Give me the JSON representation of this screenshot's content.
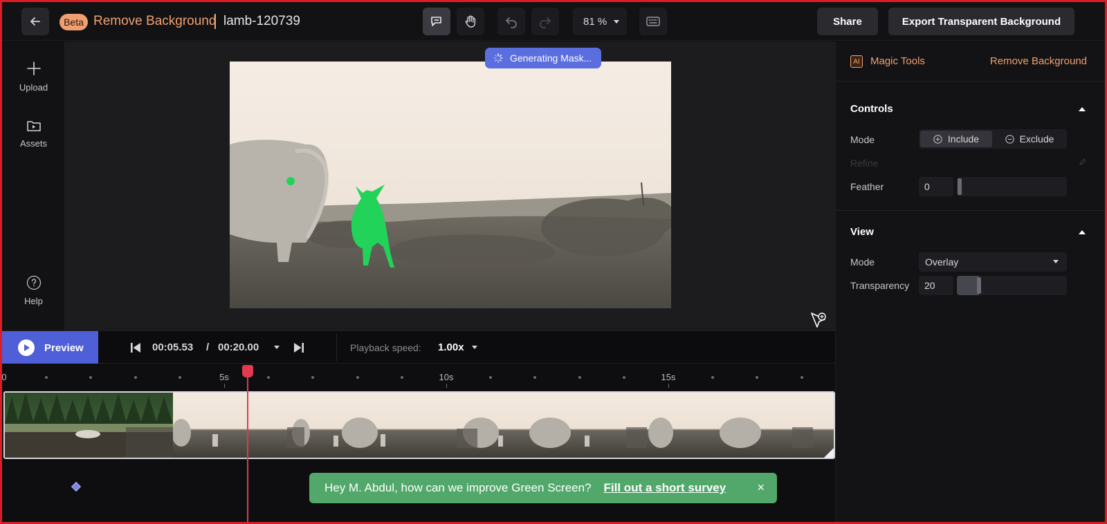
{
  "header": {
    "badge": "Beta",
    "app_title": "Remove Background",
    "file_name": "lamb-120739",
    "zoom": "81 %",
    "share_label": "Share",
    "export_label": "Export Transparent Background"
  },
  "sidebar": {
    "items": [
      {
        "label": "Upload",
        "icon": "plus-icon"
      },
      {
        "label": "Assets",
        "icon": "folder-icon"
      },
      {
        "label": "Help",
        "icon": "help-icon"
      }
    ]
  },
  "canvas": {
    "status": "Generating Mask..."
  },
  "player": {
    "preview_label": "Preview",
    "current_time": "00:05.53",
    "separator": "/",
    "total_time": "00:20.00",
    "speed_label": "Playback speed:",
    "speed_value": "1.00x"
  },
  "timeline": {
    "ticks": [
      {
        "label": "0"
      },
      {
        "label": "5s"
      },
      {
        "label": "10s"
      },
      {
        "label": "15s"
      }
    ],
    "playhead_seconds": 5.53,
    "duration_seconds": 20
  },
  "toast": {
    "message": "Hey M. Abdul, how can we improve Green Screen?",
    "link": "Fill out a short survey",
    "close": "×"
  },
  "panel": {
    "ai_badge": "AI",
    "title": "Magic Tools",
    "tool": "Remove Background",
    "controls": {
      "title": "Controls",
      "mode_label": "Mode",
      "include_label": "Include",
      "exclude_label": "Exclude",
      "refine_label": "Refine",
      "feather_label": "Feather",
      "feather_value": "0"
    },
    "view": {
      "title": "View",
      "mode_label": "Mode",
      "mode_value": "Overlay",
      "transparency_label": "Transparency",
      "transparency_value": "20"
    }
  },
  "colors": {
    "accent": "#4e5fd8",
    "brand_orange": "#f0a070",
    "playhead": "#e23a50",
    "mask_green": "#22d35a",
    "toast_green": "#52a86a"
  }
}
